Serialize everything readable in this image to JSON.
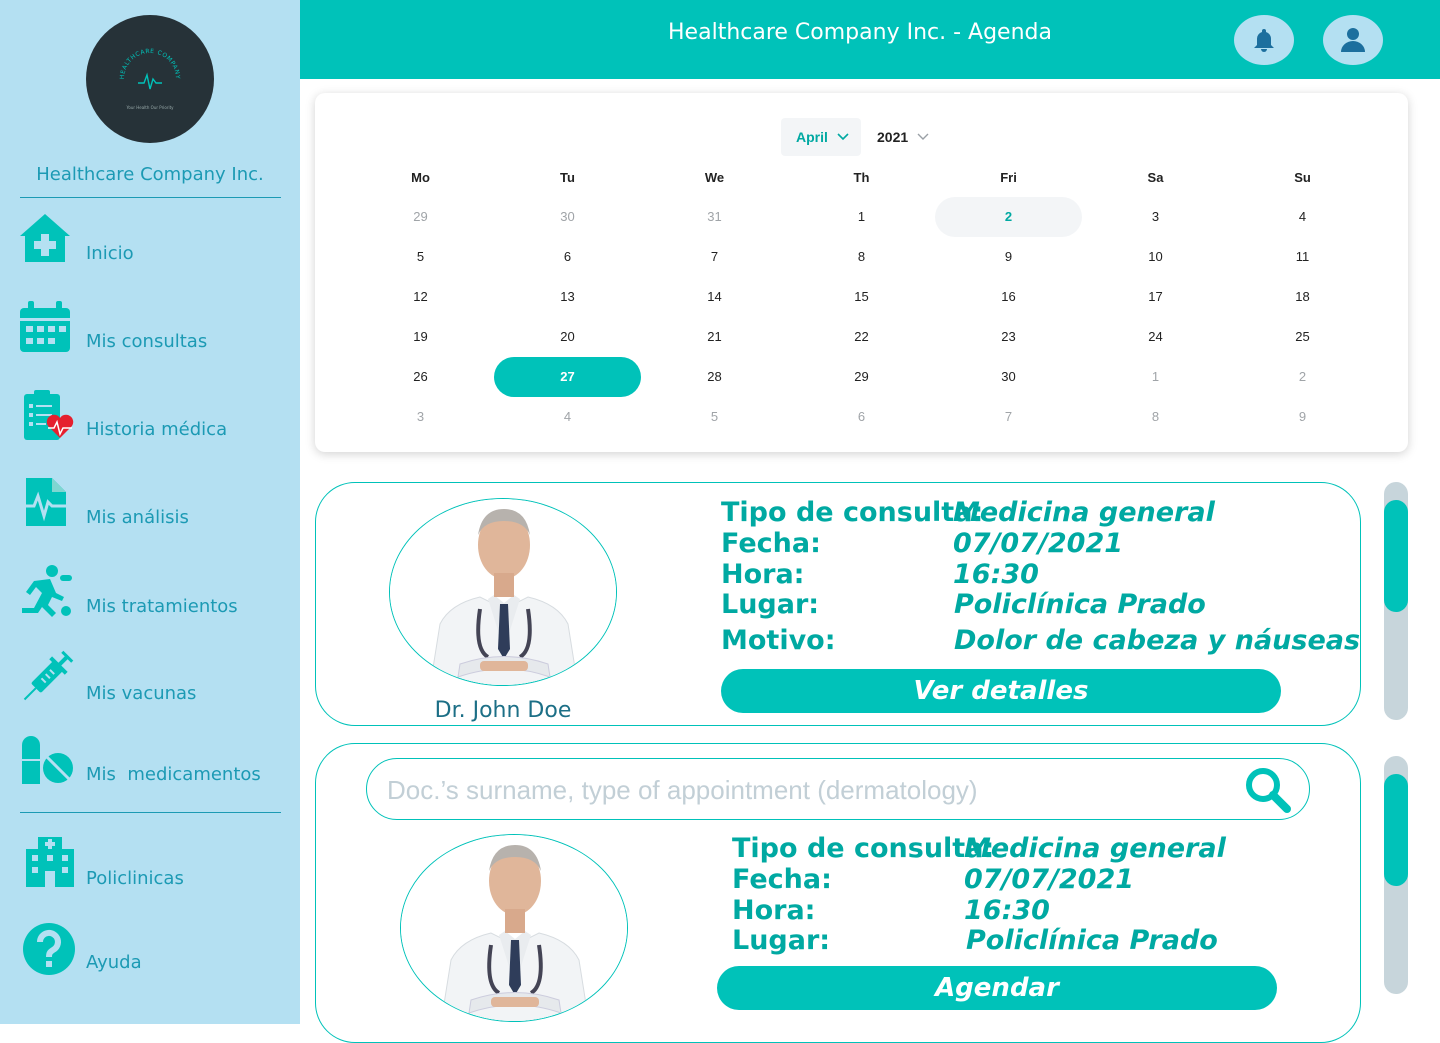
{
  "header": {
    "title": "Healthcare Company Inc. - Agenda"
  },
  "sidebar": {
    "logo_text": "HEALTHCARE COMPANY",
    "logo_tagline": "Your Health Our Priority",
    "company_name": "Healthcare Company Inc.",
    "items": [
      {
        "label": "Inicio",
        "icon": "home-medical-icon"
      },
      {
        "label": "Mis consultas",
        "icon": "calendar-icon"
      },
      {
        "label": "Historia médica",
        "icon": "clipboard-heart-icon"
      },
      {
        "label": "Mis análisis",
        "icon": "file-waveform-icon"
      },
      {
        "label": "Mis tratamientos",
        "icon": "running-person-icon"
      },
      {
        "label": "Mis vacunas",
        "icon": "syringe-icon"
      },
      {
        "label": "Mis  medicamentos",
        "icon": "pills-icon"
      },
      {
        "label": "Policlinicas",
        "icon": "hospital-icon"
      },
      {
        "label": "Ayuda",
        "icon": "help-icon"
      }
    ]
  },
  "calendar": {
    "month": "April",
    "year": "2021",
    "weekdays": [
      "Mo",
      "Tu",
      "We",
      "Th",
      "Fri",
      "Sa",
      "Su"
    ],
    "weeks": [
      [
        "29",
        "30",
        "31",
        "1",
        "2",
        "3",
        "4"
      ],
      [
        "5",
        "6",
        "7",
        "8",
        "9",
        "10",
        "11"
      ],
      [
        "12",
        "13",
        "14",
        "15",
        "16",
        "17",
        "18"
      ],
      [
        "19",
        "20",
        "21",
        "22",
        "23",
        "24",
        "25"
      ],
      [
        "26",
        "27",
        "28",
        "29",
        "30",
        "1",
        "2"
      ],
      [
        "3",
        "4",
        "5",
        "6",
        "7",
        "8",
        "9"
      ]
    ],
    "today": "2",
    "selected": "27"
  },
  "appointment_card": {
    "doctor_name": "Dr. John Doe",
    "labels": {
      "type": "Tipo de consulta:",
      "date": "Fecha:",
      "time": "Hora:",
      "place": "Lugar:",
      "reason": "Motivo:"
    },
    "values": {
      "type": "Medicina general",
      "date": "07/07/2021",
      "time": "16:30",
      "place": "Policlínica Prado",
      "reason": "Dolor de cabeza y náuseas"
    },
    "button_label": "Ver detalles"
  },
  "booking_card": {
    "search_placeholder": "Doc.’s surname, type of appointment (dermatology)",
    "labels": {
      "type": "Tipo de consulta:",
      "date": "Fecha:",
      "time": "Hora:",
      "place": "Lugar:"
    },
    "values": {
      "type": "Medicina general",
      "date": "07/07/2021",
      "time": "16:30",
      "place": "Policlínica Prado"
    },
    "button_label": "Agendar"
  },
  "colors": {
    "accent": "#00c2b9",
    "sidebar": "#b4e0f2",
    "text_blue": "#1c9ab4",
    "logo_bg": "#263238"
  }
}
